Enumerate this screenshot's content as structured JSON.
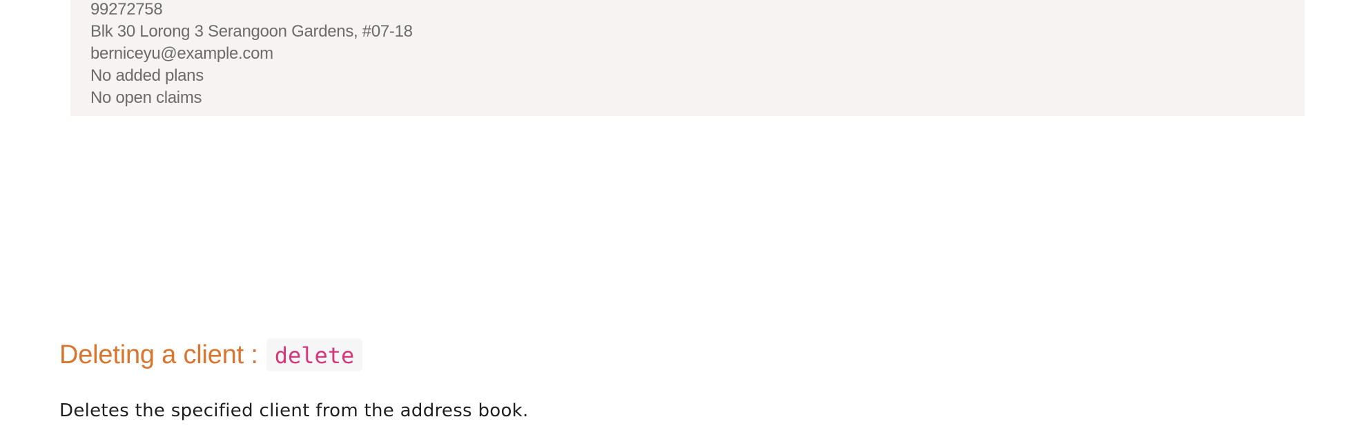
{
  "client_card": {
    "phone": "99272758",
    "address": "Blk 30 Lorong 3 Serangoon Gardens, #07-18",
    "email": "berniceyu@example.com",
    "plans": "No added plans",
    "claims": "No open claims"
  },
  "section": {
    "heading": "Deleting a client :",
    "command": "delete",
    "description": "Deletes the specified client from the address book."
  },
  "colors": {
    "heading": "#d9752e",
    "command": "#d6377a",
    "card_background": "#f8f3f3"
  }
}
